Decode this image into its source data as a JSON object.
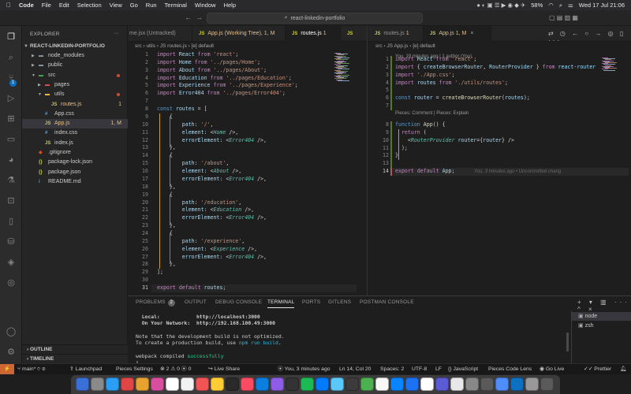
{
  "menubar": {
    "app": "Code",
    "items": [
      "File",
      "Edit",
      "Selection",
      "View",
      "Go",
      "Run",
      "Terminal",
      "Window",
      "Help"
    ],
    "battery": "58%",
    "clock": "Wed 17 Jul  21:06"
  },
  "titlebar": {
    "search": "react-linkedin-portfolio"
  },
  "explorer": {
    "header": "EXPLORER",
    "project": "REACT-LINKEDIN-PORTFOLIO",
    "tree": [
      {
        "name": "node_modules",
        "kind": "folder",
        "indent": 1,
        "open": false
      },
      {
        "name": "public",
        "kind": "folder",
        "indent": 1,
        "open": false
      },
      {
        "name": "src",
        "kind": "folder",
        "indent": 1,
        "open": true,
        "dot": true
      },
      {
        "name": "pages",
        "kind": "folder",
        "indent": 2,
        "open": false
      },
      {
        "name": "utils",
        "kind": "folder",
        "indent": 2,
        "open": true,
        "dot": true
      },
      {
        "name": "routes.js",
        "kind": "js",
        "indent": 3,
        "mark": "1"
      },
      {
        "name": "App.css",
        "kind": "css",
        "indent": 2
      },
      {
        "name": "App.js",
        "kind": "js",
        "indent": 2,
        "mark": "1, M",
        "selected": true
      },
      {
        "name": "index.css",
        "kind": "css",
        "indent": 2
      },
      {
        "name": "index.js",
        "kind": "js",
        "indent": 2
      },
      {
        "name": ".gitignore",
        "kind": "git",
        "indent": 1
      },
      {
        "name": "package-lock.json",
        "kind": "json",
        "indent": 1
      },
      {
        "name": "package.json",
        "kind": "json",
        "indent": 1
      },
      {
        "name": "README.md",
        "kind": "md",
        "indent": 1
      }
    ],
    "outline": "OUTLINE",
    "timeline": "TIMELINE"
  },
  "left_editor": {
    "tabs": [
      {
        "label": "me.jsx (Untracked)",
        "kind": "",
        "active": false
      },
      {
        "label": "App.js (Working Tree)",
        "kind": "JS",
        "mark": "1, M",
        "active": false
      },
      {
        "label": "routes.js",
        "kind": "JS",
        "mark": "1",
        "active": true
      },
      {
        "label": "",
        "kind": "JS",
        "active": false
      }
    ],
    "breadcrumb": "src › utils › JS routes.js › [e] default",
    "lines": [
      "import React from 'react';",
      "import Home from '../pages/Home';",
      "import About from '../pages/About';",
      "import Education from '../pages/Education';",
      "import Experience from '../pages/Experience';",
      "import Error404 from '../pages/Error404';",
      "",
      "const routes = [",
      "    {",
      "        path: '/',",
      "        element: <Home />,",
      "        errorElement: <Error404 />,",
      "    },",
      "    {",
      "        path: '/about',",
      "        element: <About />,",
      "        errorElement: <Error404 />,",
      "    },",
      "    {",
      "        path: '/education',",
      "        element: <Education />,",
      "        errorElement: <Error404 />,",
      "    },",
      "    {",
      "        path: '/experience',",
      "        element: <Experience />,",
      "        errorElement: <Error404 />,",
      "    },",
      "];",
      "",
      "export default routes;"
    ]
  },
  "right_editor": {
    "tabs": [
      {
        "label": "routes.js",
        "kind": "JS",
        "mark": "1",
        "active": false
      },
      {
        "label": "App.js",
        "kind": "JS",
        "mark": "1, M",
        "active": true
      }
    ],
    "breadcrumb": "src › JS App.js › [e] default",
    "blame_top": "You, 19 minutes ago | 1 author (You)",
    "lens": "Pieces: Comment | Pieces: Explain",
    "lines": [
      "import React from 'react';",
      "import { createBrowserRouter, RouterProvider } from 'react-router",
      "import './App.css';",
      "import routes from './utils/routes';",
      "",
      "const router = createBrowserRouter(routes);",
      "",
      "function App() {",
      "  return (",
      "    <RouterProvider router={router} />",
      "  );",
      "}",
      "",
      "export default App;"
    ],
    "ghost": "You, 3 minutes ago • Uncommitted chang"
  },
  "panel": {
    "tabs": [
      "PROBLEMS",
      "OUTPUT",
      "DEBUG CONSOLE",
      "TERMINAL",
      "PORTS",
      "GITLENS",
      "POSTMAN CONSOLE"
    ],
    "problems_count": "2",
    "active_tab": "TERMINAL",
    "terminal": [
      "  Local:            http://localhost:3000",
      "  On Your Network:  http://192.168.100.49:3000",
      "",
      "Note that the development build is not optimized.",
      "To create a production build, use npm run build.",
      "",
      "webpack compiled successfully"
    ],
    "terminals": [
      "node",
      "zsh"
    ]
  },
  "statusbar": {
    "branch": "main*",
    "launchpad": "Launchpad",
    "pieces": "Pieces Settings",
    "problems": "2",
    "warnings": "0",
    "ports": "0",
    "live_share": "Live Share",
    "blame": "You, 3 minutes ago",
    "position": "Ln 14, Col 20",
    "spaces": "Spaces: 2",
    "encoding": "UTF-8",
    "eol": "LF",
    "language": "JavaScript",
    "lens": "Pieces Code Lens",
    "golive": "Go Live",
    "prettier": "Prettier"
  },
  "colors": {
    "accent": "#0e70c0",
    "remote": "#cc6633",
    "keyword": "#c586c0",
    "string": "#ce9178",
    "component": "#4ec9b0"
  }
}
